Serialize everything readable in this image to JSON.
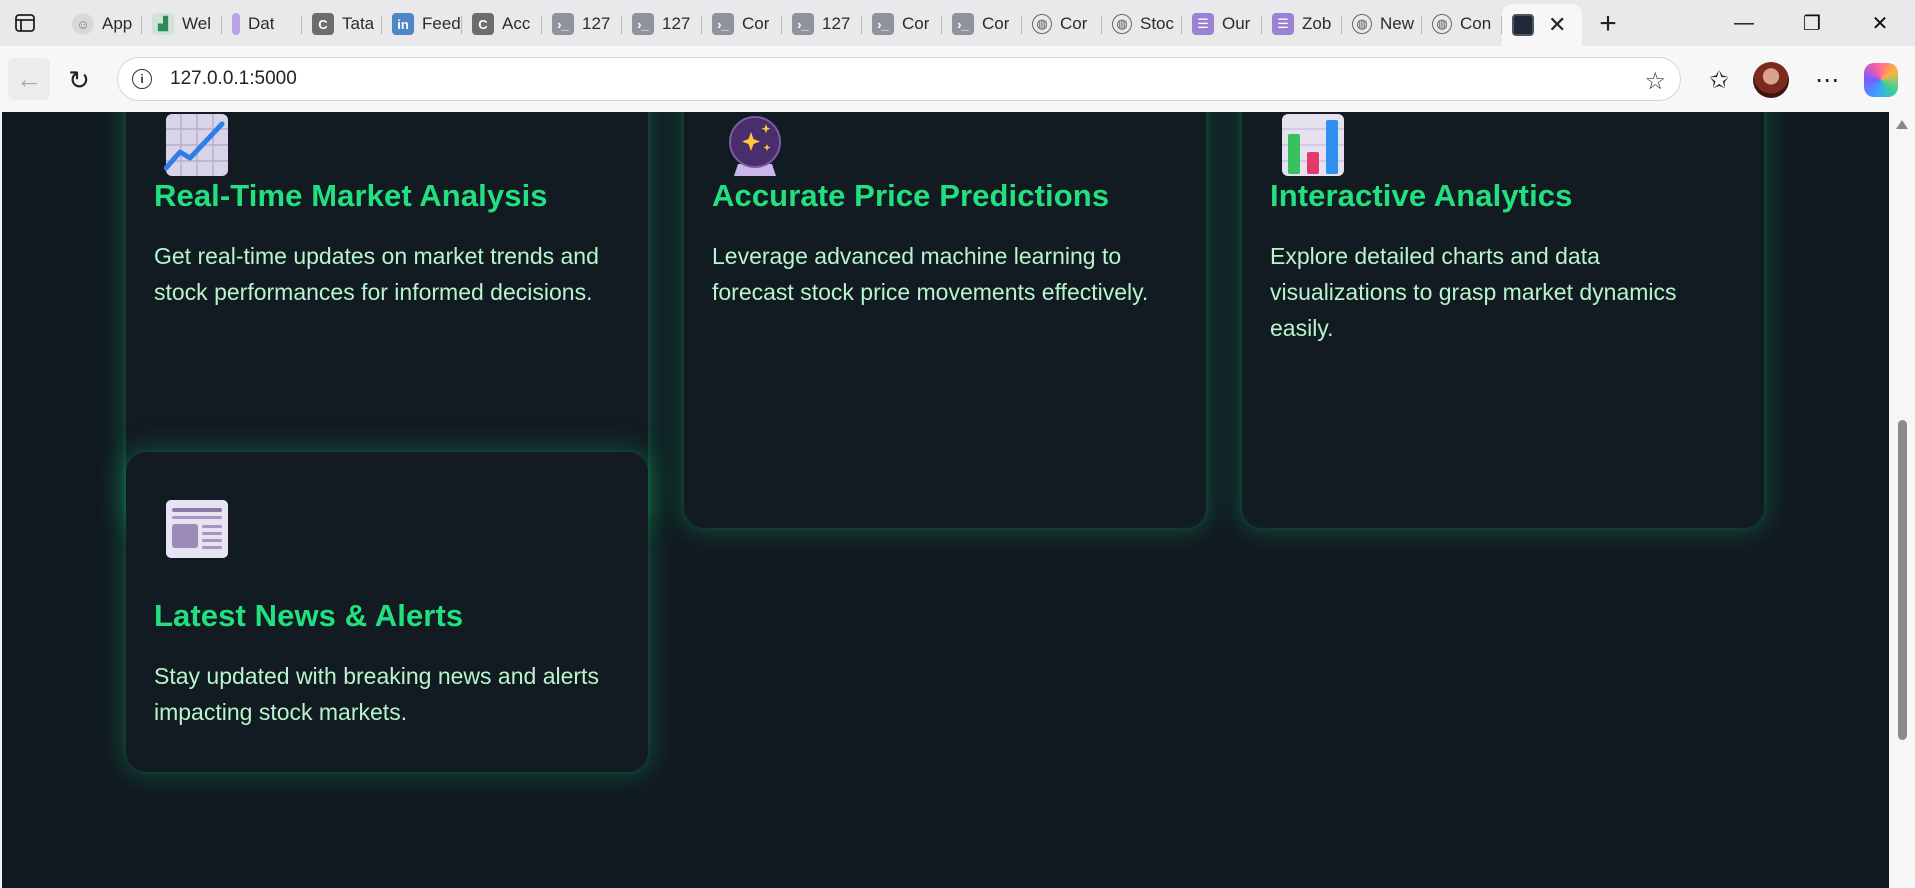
{
  "browser": {
    "tabs": [
      {
        "title": "App",
        "icon": "user-circle-icon"
      },
      {
        "title": "Wel",
        "icon": "chart-favicon-icon"
      },
      {
        "title": "Dat",
        "icon": "bar-favicon-icon"
      },
      {
        "title": "Tata",
        "icon": "c-logo-icon"
      },
      {
        "title": "Feed",
        "icon": "linkedin-icon"
      },
      {
        "title": "Acc",
        "icon": "c-logo-icon"
      },
      {
        "title": "127",
        "icon": "terminal-icon"
      },
      {
        "title": "127",
        "icon": "terminal-icon"
      },
      {
        "title": "Cor",
        "icon": "terminal-icon"
      },
      {
        "title": "127",
        "icon": "terminal-icon"
      },
      {
        "title": "Cor",
        "icon": "terminal-icon"
      },
      {
        "title": "Cor",
        "icon": "terminal-icon"
      },
      {
        "title": "Cor",
        "icon": "globe-icon"
      },
      {
        "title": "Stoc",
        "icon": "globe-icon"
      },
      {
        "title": "Our",
        "icon": "list-icon"
      },
      {
        "title": "Zob",
        "icon": "list-icon"
      },
      {
        "title": "New",
        "icon": "globe-icon"
      },
      {
        "title": "Con",
        "icon": "globe-icon"
      }
    ],
    "active_tab_close": "✕",
    "new_tab": "+",
    "window_controls": {
      "minimize": "—",
      "maximize": "❐",
      "close": "✕"
    },
    "address": {
      "url": "127.0.0.1:5000",
      "info_glyph": "i"
    }
  },
  "page": {
    "features": [
      {
        "title": "Real-Time Market Analysis",
        "description": "Get real-time updates on market trends and stock performances for informed decisions.",
        "icon": "line-chart-icon"
      },
      {
        "title": "Accurate Price Predictions",
        "description": "Leverage advanced machine learning to forecast stock price movements effectively.",
        "icon": "crystal-ball-icon"
      },
      {
        "title": "Interactive Analytics",
        "description": "Explore detailed charts and data visualizations to grasp market dynamics easily.",
        "icon": "bar-chart-icon"
      },
      {
        "title": "Latest News & Alerts",
        "description": "Stay updated with breaking news and alerts impacting stock markets.",
        "icon": "newspaper-icon"
      }
    ]
  },
  "colors": {
    "page_bg": "#111920",
    "card_bg": "#121a22",
    "accent_green": "#22e07f",
    "text_mint": "#b7f5cc"
  }
}
